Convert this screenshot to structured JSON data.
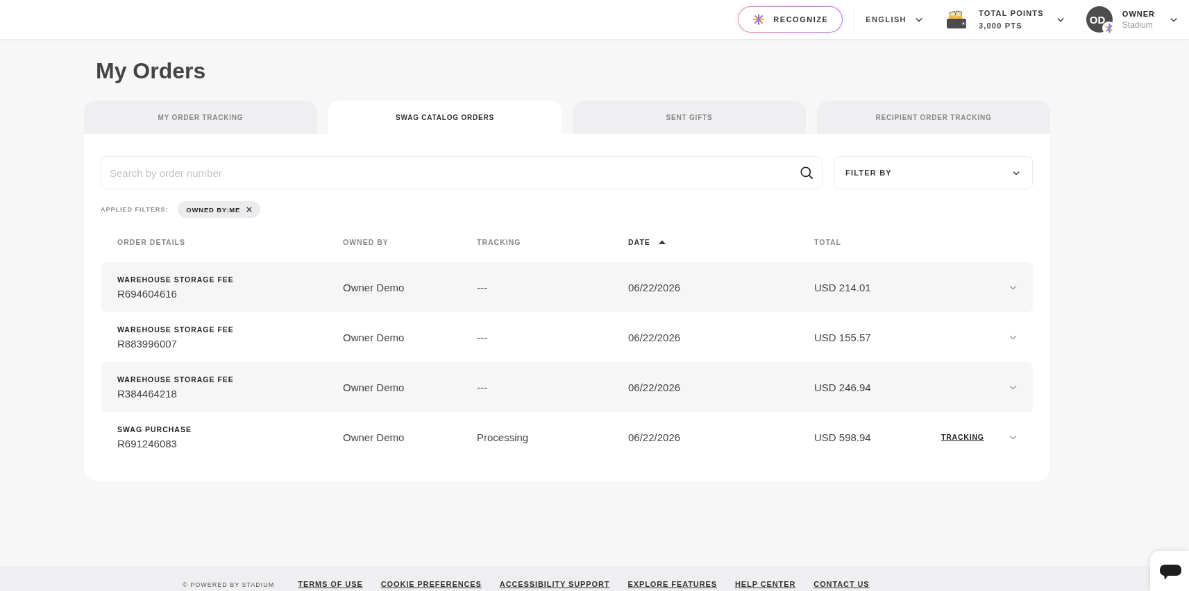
{
  "top_bar": {
    "recognize_button": "RECOGNIZE",
    "language": "ENGLISH",
    "points": {
      "label": "TOTAL POINTS",
      "value": "3,000 PTS"
    },
    "user": {
      "initials": "OD",
      "name": "OWNER",
      "company": "Stadium"
    }
  },
  "page_title": "My Orders",
  "tabs": [
    {
      "label": "MY ORDER TRACKING",
      "selected": false
    },
    {
      "label": "SWAG CATALOG ORDERS",
      "selected": true
    },
    {
      "label": "SENT GIFTS",
      "selected": false
    },
    {
      "label": "RECIPIENT ORDER TRACKING",
      "selected": false
    }
  ],
  "search": {
    "placeholder": "Search by order number"
  },
  "filter_dropdown": {
    "label": "FILTER BY"
  },
  "applied_filters": {
    "label": "APPLIED FILTERS:",
    "chips": [
      {
        "label": "OWNED BY:ME"
      }
    ]
  },
  "table": {
    "columns": [
      {
        "label": "ORDER DETAILS",
        "sorted": false
      },
      {
        "label": "OWNED BY",
        "sorted": false
      },
      {
        "label": "TRACKING",
        "sorted": false
      },
      {
        "label": "DATE",
        "sorted": true
      },
      {
        "label": "TOTAL",
        "sorted": false
      }
    ],
    "rows": [
      {
        "title": "WAREHOUSE STORAGE FEE",
        "order_number": "R694604616",
        "owned_by": "Owner Demo",
        "tracking": "---",
        "date": "06/22/2026",
        "total": "USD 214.01",
        "expanded": false
      },
      {
        "title": "WAREHOUSE STORAGE FEE",
        "order_number": "R883996007",
        "owned_by": "Owner Demo",
        "tracking": "---",
        "date": "06/22/2026",
        "total": "USD 155.57",
        "expanded": false
      },
      {
        "title": "WAREHOUSE STORAGE FEE",
        "order_number": "R384464218",
        "owned_by": "Owner Demo",
        "tracking": "---",
        "date": "06/22/2026",
        "total": "USD 246.94",
        "expanded": false
      },
      {
        "title": "SWAG PURCHASE",
        "order_number": "R691246083",
        "owned_by": "Owner Demo",
        "tracking": "Processing",
        "date": "06/22/2026",
        "total": "USD 598.94",
        "tracking_link": "TRACKING",
        "expanded": false
      }
    ]
  },
  "footer": {
    "copyright": "© POWERED BY STADIUM",
    "links": [
      "TERMS OF USE",
      "COOKIE PREFERENCES",
      "ACCESSIBILITY SUPPORT",
      "EXPLORE FEATURES",
      "HELP CENTER",
      "CONTACT US"
    ]
  }
}
